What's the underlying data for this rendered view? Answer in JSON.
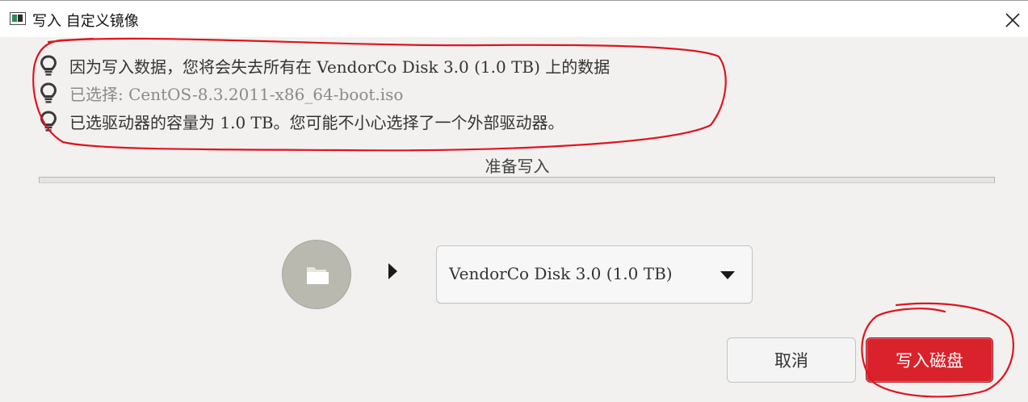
{
  "window": {
    "title": "写入 自定义镜像",
    "app_icon": "fedora-media-writer-icon",
    "close_icon": "close-icon"
  },
  "messages": [
    {
      "text": "因为写入数据，您将会失去所有在 VendorCo Disk 3.0 (1.0 TB) 上的数据",
      "icon": "lightbulb-icon"
    },
    {
      "text": "已选择: CentOS-8.3.2011-x86_64-boot.iso",
      "icon": "lightbulb-icon"
    },
    {
      "text": "已选驱动器的容量为 1.0 TB。您可能不小心选择了一个外部驱动器。",
      "icon": "lightbulb-icon"
    }
  ],
  "status": {
    "label": "准备写入",
    "progress": 0
  },
  "source": {
    "icon": "folder-icon"
  },
  "drive_select": {
    "selected": "VendorCo Disk 3.0 (1.0 TB)",
    "icon": "chevron-down-icon"
  },
  "buttons": {
    "cancel": "取消",
    "write": "写入磁盘"
  },
  "colors": {
    "accent": "#d9222b",
    "annotation": "#e0141e",
    "background": "#f2f1f0"
  }
}
